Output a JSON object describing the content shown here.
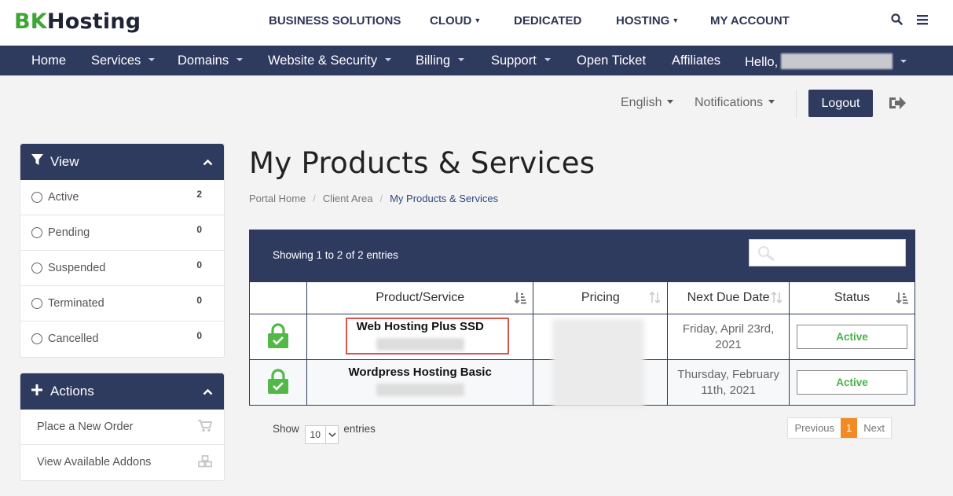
{
  "brand": {
    "logo_bk": "BK",
    "logo_host": "Hosting",
    "green": "#3fa535",
    "navy": "#2f3a5f"
  },
  "topnav": [
    {
      "label": "BUSINESS SOLUTIONS",
      "has_dropdown": false
    },
    {
      "label": "CLOUD",
      "has_dropdown": true
    },
    {
      "label": "DEDICATED",
      "has_dropdown": false
    },
    {
      "label": "HOSTING",
      "has_dropdown": true
    },
    {
      "label": "MY ACCOUNT",
      "has_dropdown": false
    }
  ],
  "top_icons": [
    "search-icon",
    "menu-icon"
  ],
  "mainnav": [
    {
      "label": "Home",
      "has_dropdown": false
    },
    {
      "label": "Services",
      "has_dropdown": true
    },
    {
      "label": "Domains",
      "has_dropdown": true
    },
    {
      "label": "Website & Security",
      "has_dropdown": true
    },
    {
      "label": "Billing",
      "has_dropdown": true
    },
    {
      "label": "Support",
      "has_dropdown": true
    },
    {
      "label": "Open Ticket",
      "has_dropdown": false
    },
    {
      "label": "Affiliates",
      "has_dropdown": false
    },
    {
      "label": "Hello,",
      "has_dropdown": true
    }
  ],
  "util": {
    "language": "English",
    "notifications": "Notifications",
    "logout": "Logout"
  },
  "sidebar": {
    "view": {
      "title": "View",
      "items": [
        {
          "label": "Active",
          "count": "2"
        },
        {
          "label": "Pending",
          "count": "0"
        },
        {
          "label": "Suspended",
          "count": "0"
        },
        {
          "label": "Terminated",
          "count": "0"
        },
        {
          "label": "Cancelled",
          "count": "0"
        }
      ]
    },
    "actions": {
      "title": "Actions",
      "items": [
        {
          "label": "Place a New Order",
          "icon": "cart-icon"
        },
        {
          "label": "View Available Addons",
          "icon": "cubes-icon"
        }
      ]
    }
  },
  "page": {
    "title": "My Products & Services",
    "breadcrumb": [
      "Portal Home",
      "Client Area",
      "My Products & Services"
    ]
  },
  "table": {
    "info": "Showing 1 to 2 of 2 entries",
    "search_placeholder": "",
    "columns": [
      "Product/Service",
      "Pricing",
      "Next Due Date",
      "Status"
    ],
    "rows": [
      {
        "product": "Web Hosting Plus SSD",
        "due_line1": "Friday, April 23rd,",
        "due_line2": "2021",
        "status": "Active"
      },
      {
        "product": "Wordpress Hosting Basic",
        "due_line1": "Thursday, February",
        "due_line2": "11th, 2021",
        "status": "Active"
      }
    ],
    "show_label": "Show",
    "show_value": "10",
    "entries_label": "entries",
    "pager": {
      "previous": "Previous",
      "page": "1",
      "next": "Next"
    }
  }
}
